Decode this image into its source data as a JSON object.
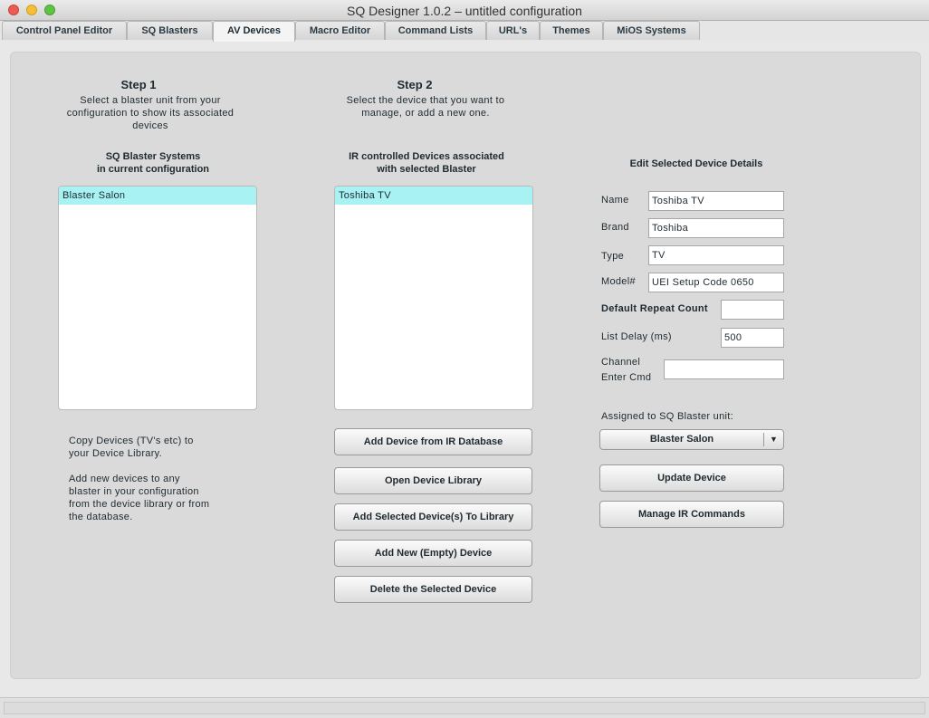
{
  "window": {
    "title": "SQ Designer 1.0.2 – untitled configuration",
    "controls": [
      "close-icon",
      "minimize-icon",
      "zoom-icon"
    ]
  },
  "tabs": [
    {
      "label": "Control Panel Editor",
      "active": false
    },
    {
      "label": "SQ Blasters",
      "active": false
    },
    {
      "label": "AV Devices",
      "active": true
    },
    {
      "label": "Macro Editor",
      "active": false
    },
    {
      "label": "Command Lists",
      "active": false
    },
    {
      "label": "URL's",
      "active": false
    },
    {
      "label": "Themes",
      "active": false
    },
    {
      "label": "MiOS Systems",
      "active": false
    }
  ],
  "step1": {
    "title": "Step 1",
    "description": [
      "Select a blaster unit from your",
      "configuration to show its associated",
      "devices"
    ],
    "list_header": [
      "SQ Blaster Systems",
      "in current configuration"
    ],
    "items": [
      "Blaster Salon"
    ],
    "selected": "Blaster Salon",
    "help": [
      "Copy Devices (TV's etc) to",
      "your Device Library.",
      "",
      "Add new devices to any",
      "blaster in your configuration",
      "from the device library or from",
      "the database."
    ]
  },
  "step2": {
    "title": "Step 2",
    "description": [
      "Select the device that you want to",
      "manage, or add a new one."
    ],
    "list_header": [
      "IR controlled Devices associated",
      "with selected Blaster"
    ],
    "items": [
      "Toshiba TV"
    ],
    "selected": "Toshiba TV",
    "buttons": {
      "add_from_db": "Add Device from IR Database",
      "open_library": "Open Device Library",
      "add_to_library": "Add Selected Device(s) To Library",
      "add_new": "Add New (Empty) Device",
      "delete": "Delete the Selected Device"
    }
  },
  "details": {
    "heading": "Edit Selected Device Details",
    "name_label": "Name",
    "name_value": "Toshiba TV",
    "brand_label": "Brand",
    "brand_value": "Toshiba",
    "type_label": "Type",
    "type_value": "TV",
    "model_label": "Model#",
    "model_value": "UEI Setup Code 0650",
    "repeat_label": "Default Repeat Count",
    "repeat_value": "",
    "delay_label": "List Delay (ms)",
    "delay_value": "500",
    "channel_label": [
      "Channel",
      "Enter Cmd"
    ],
    "channel_value": "",
    "assigned_label": "Assigned to SQ Blaster unit:",
    "assigned_value": "Blaster Salon",
    "update_button": "Update Device",
    "manage_button": "Manage IR Commands"
  }
}
